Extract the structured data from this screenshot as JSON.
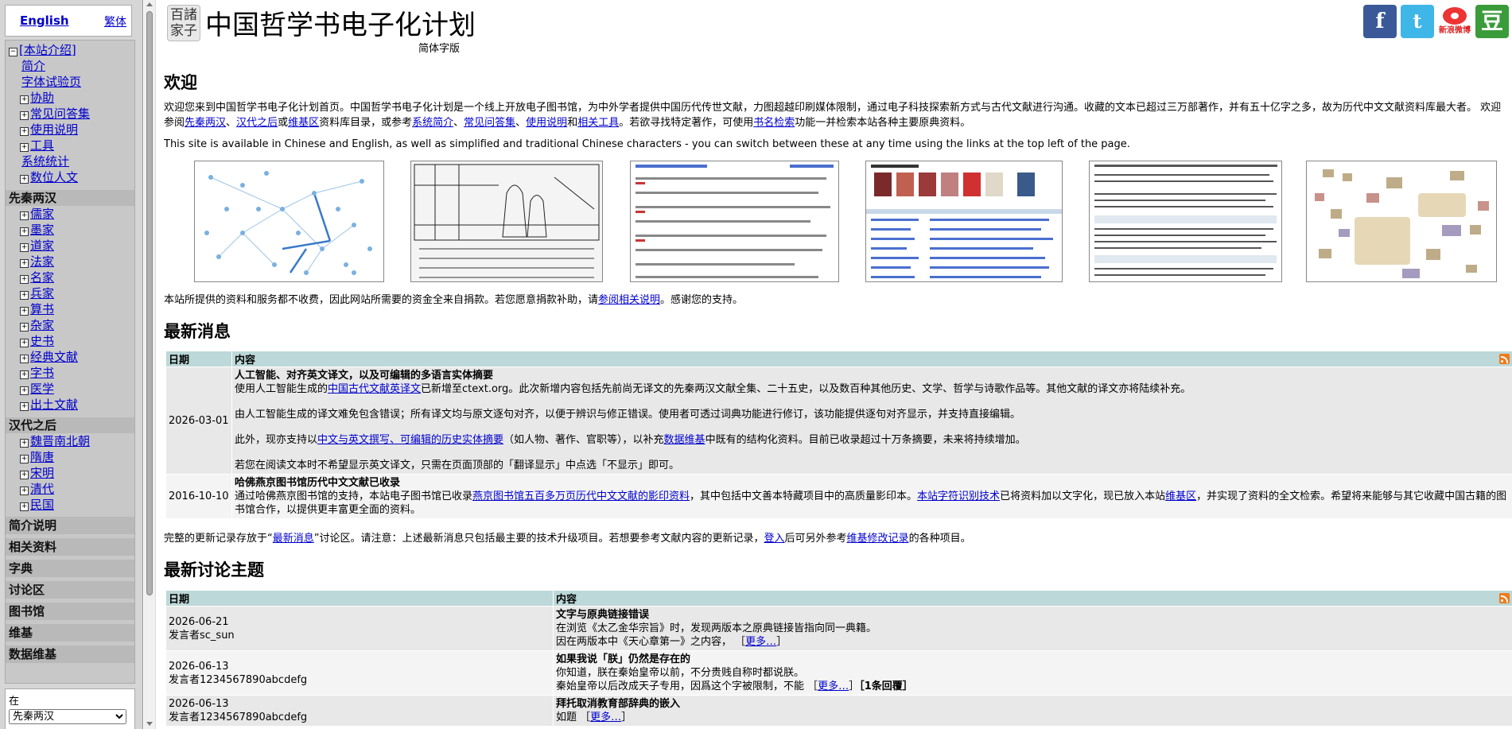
{
  "lang": {
    "english": "English",
    "traditional": "繁体"
  },
  "nav": {
    "intro": {
      "label": "[本站介绍]",
      "items": [
        "简介",
        "字体试验页",
        "协助",
        "常见问答集",
        "使用说明",
        "工具",
        "系统统计",
        "数位人文"
      ]
    },
    "pre_qin": {
      "label": "先秦两汉",
      "items": [
        "儒家",
        "墨家",
        "道家",
        "法家",
        "名家",
        "兵家",
        "算书",
        "杂家",
        "史书",
        "经典文献",
        "字书",
        "医学",
        "出土文献"
      ]
    },
    "post_han": {
      "label": "汉代之后",
      "items": [
        "魏晋南北朝",
        "隋唐",
        "宋明",
        "清代",
        "民国"
      ]
    },
    "bottom": [
      "简介说明",
      "相关资料",
      "字典",
      "讨论区",
      "图书馆",
      "维基",
      "数据维基"
    ]
  },
  "search": {
    "label": "在",
    "selected": "先秦两汉"
  },
  "header": {
    "logo_text": "百諸 家子",
    "title": "中国哲学书电子化计划",
    "subtitle": "简体字版",
    "weibo_label": "新浪微博"
  },
  "welcome": {
    "heading": "欢迎",
    "p1_a": "欢迎您来到中国哲学书电子化计划首页。中国哲学书电子化计划是一个线上开放电子图书馆，为中外学者提供中国历代传世文献，力图超越印刷媒体限制，通过电子科技探索新方式与古代文献进行沟通。收藏的文本已超过三万部著作，并有五十亿字之多，故为历代中文文献资料库最大者。 欢迎参阅",
    "p1_link1": "先秦两汉",
    "p1_sep1": "、",
    "p1_link2": "汉代之后",
    "p1_or": "或",
    "p1_link3": "维基区",
    "p1_b": "资料库目录，或参考",
    "p1_link4": "系统简介",
    "p1_link5": "常见问答集",
    "p1_link6": "使用说明",
    "p1_and": "和",
    "p1_link7": "相关工具",
    "p1_c": "。若欲寻找特定著作，可使用",
    "p1_link8": "书名检索",
    "p1_d": "功能一并检索本站各种主要原典资料。",
    "p2": "This site is available in Chinese and English, as well as simplified and traditional Chinese characters - you can switch between these at any time using the links at the top left of the page.",
    "p3_a": "本站所提供的资料和服务都不收费，因此网站所需要的资金全来自捐款。若您愿意捐款补助，请",
    "p3_link": "参阅相关说明",
    "p3_b": "。感谢您的支持。"
  },
  "news": {
    "heading": "最新消息",
    "col_date": "日期",
    "col_content": "内容",
    "items": [
      {
        "date": "2026-03-01",
        "title": "人工智能、对齐英文译文，以及可编辑的多语言实体摘要",
        "l1_a": "使用人工智能生成的",
        "l1_link": "中国古代文献英译文",
        "l1_b": "已新增至ctext.org。此次新增内容包括先前尚无译文的先秦两汉文献全集、二十五史，以及数百种其他历史、文学、哲学与诗歌作品等。其他文献的译文亦将陆续补充。",
        "l2": "由人工智能生成的译文难免包含错误；所有译文均与原文逐句对齐，以便于辨识与修正错误。使用者可透过词典功能进行修订，该功能提供逐句对齐显示，并支持直接编辑。",
        "l3_a": "此外，现亦支持以",
        "l3_link1": "中文与英文撰写、可编辑的历史实体摘要",
        "l3_b": "（如人物、著作、官职等），以补充",
        "l3_link2": "数据维基",
        "l3_c": "中既有的结构化资料。目前已收录超过十万条摘要，未来将持续增加。",
        "l4": "若您在阅读文本时不希望显示英文译文，只需在页面顶部的「翻译显示」中点选「不显示」即可。"
      },
      {
        "date": "2016-10-10",
        "title": "哈佛燕京图书馆历代中文文献已收录",
        "l1_a": "通过哈佛燕京图书馆的支持，本站电子图书馆已收录",
        "l1_link": "燕京图书馆五百多万页历代中文文献的影印资料",
        "l1_b": "，其中包括中文善本特藏项目中的高质量影印本。",
        "l1_link2": "本站字符识别技术",
        "l1_c": "已将资料加以文字化，现已放入本站",
        "l1_link3": "维基区",
        "l1_d": "，并实现了资料的全文检索。希望将来能够与其它收藏中国古籍的图书馆合作，以提供更丰富更全面的资料。"
      }
    ],
    "foot_a": "完整的更新记录存放于“",
    "foot_link1": "最新消息",
    "foot_b": "”讨论区。请注意：上述最新消息只包括最主要的技术升级项目。若想要参考文献内容的更新记录，",
    "foot_link2": "登入",
    "foot_c": "后可另外参考",
    "foot_link3": "维基修改记录",
    "foot_d": "的各种项目。"
  },
  "discussion": {
    "heading": "最新讨论主题",
    "col_date": "日期",
    "col_content": "内容",
    "items": [
      {
        "date": "2026-06-21",
        "author": "发言者sc_sun",
        "title": "文字与原典链接错误",
        "l1": "在浏览《太乙金华宗旨》时，发现两版本之原典链接皆指向同一典籍。",
        "l2_a": "因在两版本中《天心章第一》之内容，",
        "l2_bracket_open": "［",
        "l2_more": "更多…",
        "l2_bracket_close": "］",
        "reply": ""
      },
      {
        "date": "2026-06-13",
        "author": "发言者1234567890abcdefg",
        "title": "如果我说「朕」仍然是存在的",
        "l1": "你知道，朕在秦始皇帝以前，不分贵贱自称时都说朕。",
        "l2_a": "秦始皇帝以后改成天子专用，因爲这个字被限制，不能",
        "l2_bracket_open": "［",
        "l2_more": "更多…",
        "l2_bracket_close": "］",
        "reply": "［1条回覆］"
      },
      {
        "date": "2026-06-13",
        "author": "发言者1234567890abcdefg",
        "title": "拜托取消教育部辞典的嵌入",
        "l1": "",
        "l2_a": "如题",
        "l2_bracket_open": "［",
        "l2_more": "更多…",
        "l2_bracket_close": "］",
        "reply": ""
      }
    ]
  }
}
